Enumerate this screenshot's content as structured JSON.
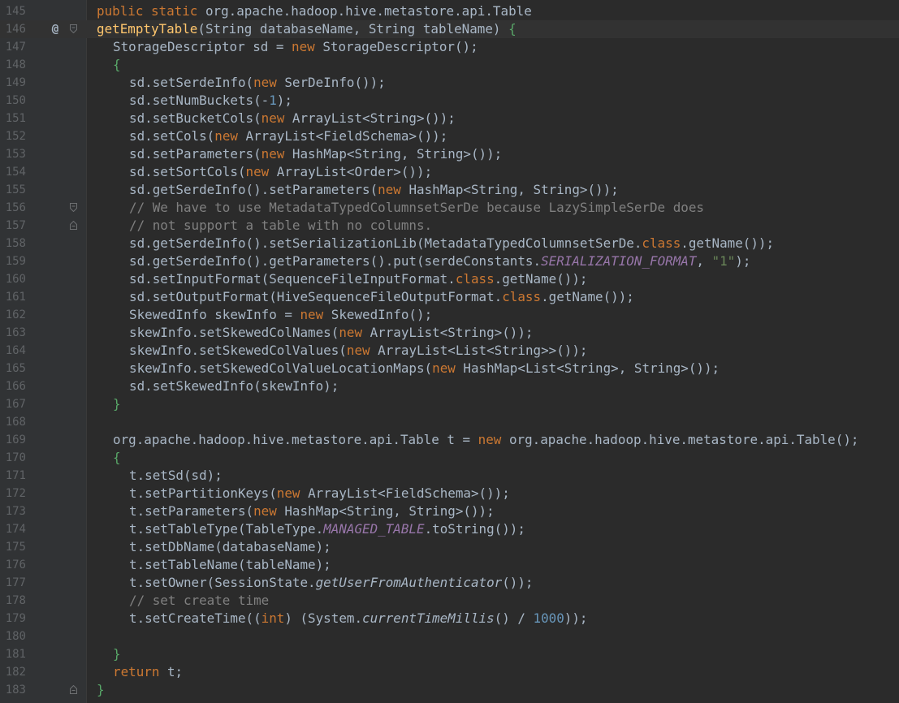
{
  "editor": {
    "colors": {
      "background": "#2b2b2b",
      "gutter": "#313335",
      "line_number": "#606366",
      "plain": "#a9b7c6",
      "keyword": "#cc7832",
      "method_decl": "#ffc66d",
      "static_field": "#9876aa",
      "comment": "#808080",
      "string": "#6a8759",
      "number": "#6897bb",
      "brace_match": "#59a869"
    },
    "current_line": 146,
    "lines": [
      {
        "n": "145",
        "indent": 0,
        "tokens": [
          [
            "kw",
            "public static "
          ],
          [
            "p",
            "org.apache.hadoop.hive.metastore.api.Table"
          ]
        ]
      },
      {
        "n": "146",
        "indent": 0,
        "mark": "@",
        "fold": "open",
        "tokens": [
          [
            "mt",
            "getEmptyTable"
          ],
          [
            "p",
            "(String databaseName, String tableName) "
          ],
          [
            "br",
            "{"
          ]
        ]
      },
      {
        "n": "147",
        "indent": 1,
        "tokens": [
          [
            "p",
            "StorageDescriptor sd = "
          ],
          [
            "kw",
            "new "
          ],
          [
            "p",
            "StorageDescriptor();"
          ]
        ]
      },
      {
        "n": "148",
        "indent": 1,
        "tokens": [
          [
            "br",
            "{"
          ]
        ]
      },
      {
        "n": "149",
        "indent": 2,
        "tokens": [
          [
            "p",
            "sd.setSerdeInfo("
          ],
          [
            "kw",
            "new "
          ],
          [
            "p",
            "SerDeInfo());"
          ]
        ]
      },
      {
        "n": "150",
        "indent": 2,
        "tokens": [
          [
            "p",
            "sd.setNumBuckets(-"
          ],
          [
            "num",
            "1"
          ],
          [
            "p",
            ");"
          ]
        ]
      },
      {
        "n": "151",
        "indent": 2,
        "tokens": [
          [
            "p",
            "sd.setBucketCols("
          ],
          [
            "kw",
            "new "
          ],
          [
            "p",
            "ArrayList<String>());"
          ]
        ]
      },
      {
        "n": "152",
        "indent": 2,
        "tokens": [
          [
            "p",
            "sd.setCols("
          ],
          [
            "kw",
            "new "
          ],
          [
            "p",
            "ArrayList<FieldSchema>());"
          ]
        ]
      },
      {
        "n": "153",
        "indent": 2,
        "tokens": [
          [
            "p",
            "sd.setParameters("
          ],
          [
            "kw",
            "new "
          ],
          [
            "p",
            "HashMap<String, String>());"
          ]
        ]
      },
      {
        "n": "154",
        "indent": 2,
        "tokens": [
          [
            "p",
            "sd.setSortCols("
          ],
          [
            "kw",
            "new "
          ],
          [
            "p",
            "ArrayList<Order>());"
          ]
        ]
      },
      {
        "n": "155",
        "indent": 2,
        "tokens": [
          [
            "p",
            "sd.getSerdeInfo().setParameters("
          ],
          [
            "kw",
            "new "
          ],
          [
            "p",
            "HashMap<String, String>());"
          ]
        ]
      },
      {
        "n": "156",
        "indent": 2,
        "fold": "open",
        "tokens": [
          [
            "cm",
            "// We have to use MetadataTypedColumnsetSerDe because LazySimpleSerDe does"
          ]
        ]
      },
      {
        "n": "157",
        "indent": 2,
        "fold": "close",
        "tokens": [
          [
            "cm",
            "// not support a table with no columns."
          ]
        ]
      },
      {
        "n": "158",
        "indent": 2,
        "tokens": [
          [
            "p",
            "sd.getSerdeInfo().setSerializationLib(MetadataTypedColumnsetSerDe."
          ],
          [
            "kw",
            "class"
          ],
          [
            "p",
            ".getName());"
          ]
        ]
      },
      {
        "n": "159",
        "indent": 2,
        "tokens": [
          [
            "p",
            "sd.getSerdeInfo().getParameters().put(serdeConstants."
          ],
          [
            "st",
            "SERIALIZATION_FORMAT"
          ],
          [
            "p",
            ", "
          ],
          [
            "str",
            "\"1\""
          ],
          [
            "p",
            ");"
          ]
        ]
      },
      {
        "n": "160",
        "indent": 2,
        "tokens": [
          [
            "p",
            "sd.setInputFormat(SequenceFileInputFormat."
          ],
          [
            "kw",
            "class"
          ],
          [
            "p",
            ".getName());"
          ]
        ]
      },
      {
        "n": "161",
        "indent": 2,
        "tokens": [
          [
            "p",
            "sd.setOutputFormat(HiveSequenceFileOutputFormat."
          ],
          [
            "kw",
            "class"
          ],
          [
            "p",
            ".getName());"
          ]
        ]
      },
      {
        "n": "162",
        "indent": 2,
        "tokens": [
          [
            "p",
            "SkewedInfo skewInfo = "
          ],
          [
            "kw",
            "new "
          ],
          [
            "p",
            "SkewedInfo();"
          ]
        ]
      },
      {
        "n": "163",
        "indent": 2,
        "tokens": [
          [
            "p",
            "skewInfo.setSkewedColNames("
          ],
          [
            "kw",
            "new "
          ],
          [
            "p",
            "ArrayList<String>());"
          ]
        ]
      },
      {
        "n": "164",
        "indent": 2,
        "tokens": [
          [
            "p",
            "skewInfo.setSkewedColValues("
          ],
          [
            "kw",
            "new "
          ],
          [
            "p",
            "ArrayList<List<String>>());"
          ]
        ]
      },
      {
        "n": "165",
        "indent": 2,
        "tokens": [
          [
            "p",
            "skewInfo.setSkewedColValueLocationMaps("
          ],
          [
            "kw",
            "new "
          ],
          [
            "p",
            "HashMap<List<String>, String>());"
          ]
        ]
      },
      {
        "n": "166",
        "indent": 2,
        "tokens": [
          [
            "p",
            "sd.setSkewedInfo(skewInfo);"
          ]
        ]
      },
      {
        "n": "167",
        "indent": 1,
        "tokens": [
          [
            "br",
            "}"
          ]
        ]
      },
      {
        "n": "168",
        "indent": 0,
        "tokens": []
      },
      {
        "n": "169",
        "indent": 1,
        "tokens": [
          [
            "p",
            "org.apache.hadoop.hive.metastore.api.Table t = "
          ],
          [
            "kw",
            "new "
          ],
          [
            "p",
            "org.apache.hadoop.hive.metastore.api.Table();"
          ]
        ]
      },
      {
        "n": "170",
        "indent": 1,
        "tokens": [
          [
            "br",
            "{"
          ]
        ]
      },
      {
        "n": "171",
        "indent": 2,
        "tokens": [
          [
            "p",
            "t.setSd(sd);"
          ]
        ]
      },
      {
        "n": "172",
        "indent": 2,
        "tokens": [
          [
            "p",
            "t.setPartitionKeys("
          ],
          [
            "kw",
            "new "
          ],
          [
            "p",
            "ArrayList<FieldSchema>());"
          ]
        ]
      },
      {
        "n": "173",
        "indent": 2,
        "tokens": [
          [
            "p",
            "t.setParameters("
          ],
          [
            "kw",
            "new "
          ],
          [
            "p",
            "HashMap<String, String>());"
          ]
        ]
      },
      {
        "n": "174",
        "indent": 2,
        "tokens": [
          [
            "p",
            "t.setTableType(TableType."
          ],
          [
            "st",
            "MANAGED_TABLE"
          ],
          [
            "p",
            ".toString());"
          ]
        ]
      },
      {
        "n": "175",
        "indent": 2,
        "tokens": [
          [
            "p",
            "t.setDbName(databaseName);"
          ]
        ]
      },
      {
        "n": "176",
        "indent": 2,
        "tokens": [
          [
            "p",
            "t.setTableName(tableName);"
          ]
        ]
      },
      {
        "n": "177",
        "indent": 2,
        "tokens": [
          [
            "p",
            "t.setOwner(SessionState."
          ],
          [
            "it",
            "getUserFromAuthenticator"
          ],
          [
            "p",
            "());"
          ]
        ]
      },
      {
        "n": "178",
        "indent": 2,
        "tokens": [
          [
            "cm",
            "// set create time"
          ]
        ]
      },
      {
        "n": "179",
        "indent": 2,
        "tokens": [
          [
            "p",
            "t.setCreateTime(("
          ],
          [
            "kw",
            "int"
          ],
          [
            "p",
            ") (System."
          ],
          [
            "it",
            "currentTimeMillis"
          ],
          [
            "p",
            "() / "
          ],
          [
            "num",
            "1000"
          ],
          [
            "p",
            "));"
          ]
        ]
      },
      {
        "n": "180",
        "indent": 0,
        "tokens": []
      },
      {
        "n": "181",
        "indent": 1,
        "tokens": [
          [
            "br",
            "}"
          ]
        ]
      },
      {
        "n": "182",
        "indent": 1,
        "tokens": [
          [
            "kw",
            "return "
          ],
          [
            "p",
            "t;"
          ]
        ]
      },
      {
        "n": "183",
        "indent": 0,
        "fold": "close",
        "tokens": [
          [
            "br",
            "}"
          ]
        ]
      }
    ]
  }
}
